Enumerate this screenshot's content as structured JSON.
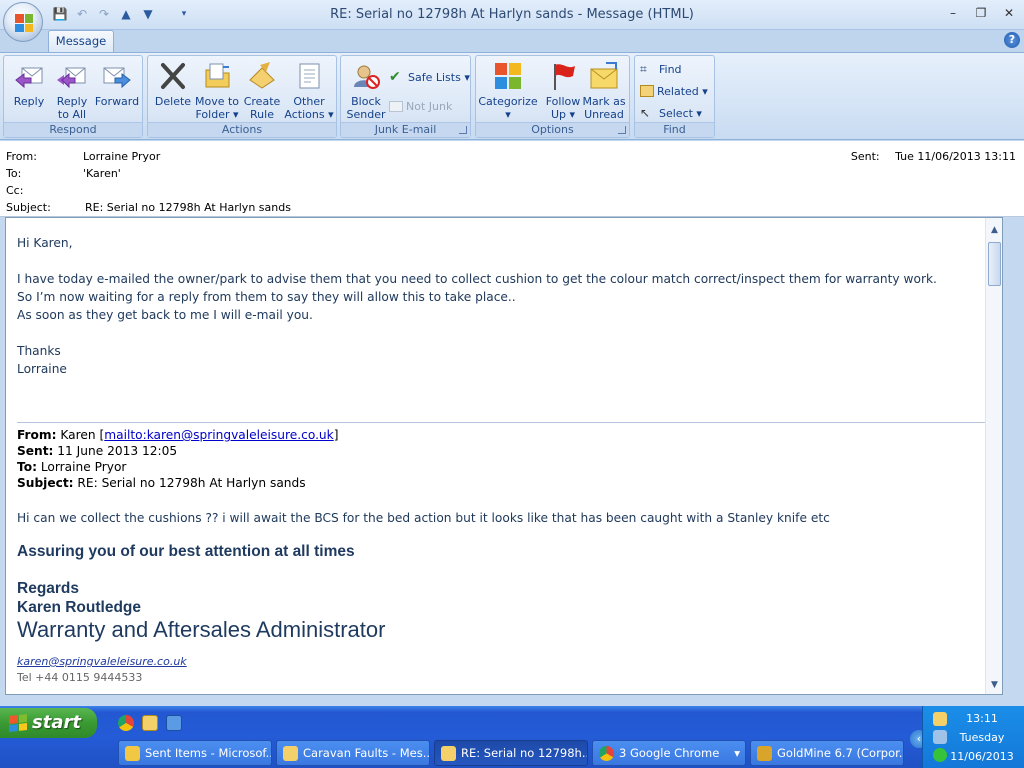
{
  "window": {
    "title": "RE: Serial no 12798h At Harlyn sands - Message (HTML)",
    "minimize": "–",
    "maximize": "❐",
    "close": "✕"
  },
  "ribbon": {
    "tab": "Message",
    "help": "?",
    "groups": {
      "respond": {
        "label": "Respond",
        "reply": "Reply",
        "reply_all_1": "Reply",
        "reply_all_2": "to All",
        "forward": "Forward"
      },
      "actions": {
        "label": "Actions",
        "delete": "Delete",
        "move_1": "Move to",
        "move_2": "Folder ▾",
        "create_1": "Create",
        "create_2": "Rule",
        "other_1": "Other",
        "other_2": "Actions ▾"
      },
      "junk": {
        "label": "Junk E-mail",
        "block_1": "Block",
        "block_2": "Sender",
        "safe_lists": "Safe Lists ▾",
        "not_junk": "Not Junk"
      },
      "options": {
        "label": "Options",
        "categorize_1": "Categorize",
        "categorize_2": "▾",
        "follow_1": "Follow",
        "follow_2": "Up ▾",
        "mark_1": "Mark as",
        "mark_2": "Unread"
      },
      "find": {
        "label": "Find",
        "find": "Find",
        "related": "Related ▾",
        "select": "Select ▾"
      }
    }
  },
  "header": {
    "from_label": "From:",
    "from": "Lorraine Pryor",
    "to_label": "To:",
    "to": "'Karen'",
    "cc_label": "Cc:",
    "cc": "",
    "subject_label": "Subject:",
    "subject": "RE: Serial no 12798h At Harlyn sands",
    "sent_label": "Sent:",
    "sent": "Tue 11/06/2013 13:11"
  },
  "body": {
    "greeting": "Hi Karen,",
    "line1": "I have today e-mailed the owner/park to advise them that you need to collect cushion to get the colour match correct/inspect them for warranty work.",
    "line2": "So I’m now waiting for a reply from them to say they will allow this to take place..",
    "line3": "As soon as they get back to me I will e-mail you.",
    "thanks": "Thanks",
    "signoff": "Lorraine",
    "quoted": {
      "from_label": "From:",
      "from_name": "Karen [",
      "from_link": "mailto:karen@springvaleleisure.co.uk",
      "from_close": "]",
      "sent_label": "Sent:",
      "sent": "11 June 2013 12:05",
      "to_label": "To:",
      "to": "Lorraine Pryor",
      "subject_label": "Subject:",
      "subject": "RE: Serial no 12798h At Harlyn sands",
      "text": "Hi can we collect the cushions ?? i will await the BCS for the bed action but it looks like that has been caught with a Stanley knife etc",
      "assure": "Assuring you of our best attention at all times",
      "regards": "Regards",
      "name": "Karen Routledge",
      "role": "Warranty and Aftersales Administrator",
      "email": "karen@springvaleleisure.co.uk",
      "tel": "Tel   +44 0115 9444533"
    }
  },
  "taskbar": {
    "start": "start",
    "buttons": [
      {
        "label": "Sent Items - Microsof...",
        "color": "#f2c744"
      },
      {
        "label": "Caravan Faults - Mes...",
        "color": "#f4d06a"
      },
      {
        "label": "RE: Serial no 12798h...",
        "color": "#f4d06a"
      },
      {
        "label": "3 Google Chrome",
        "color": "#e4443b"
      },
      {
        "label": "GoldMine 6.7 (Corpor...",
        "color": "#d8a52a"
      }
    ],
    "chrome_arrow": "▾",
    "time": "13:11",
    "day": "Tuesday",
    "date": "11/06/2013"
  },
  "colors": {
    "ribbon_text": "#15428b",
    "body_text": "#203a5c",
    "taskbar": "#245bd6",
    "start_green": "#3a9a33"
  }
}
